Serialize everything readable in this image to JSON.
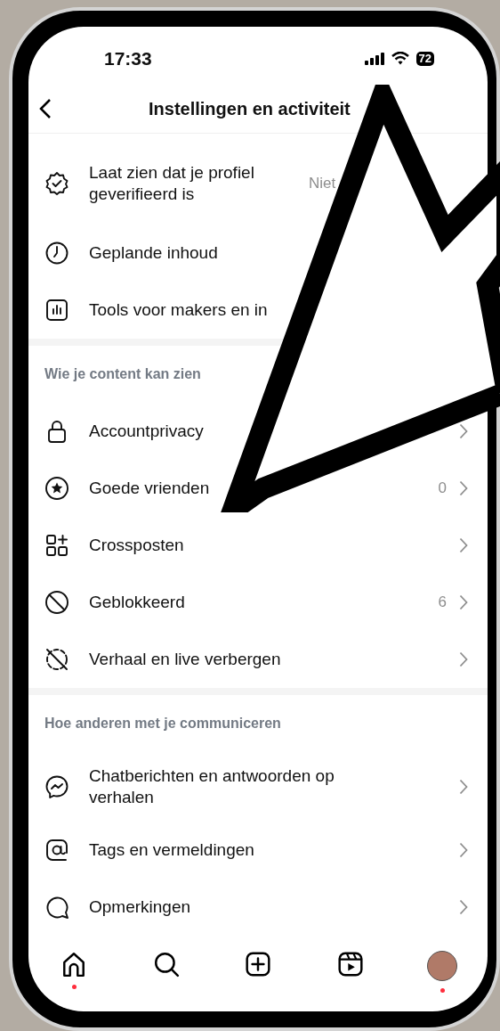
{
  "status_bar": {
    "time": "17:33",
    "battery": "72"
  },
  "header": {
    "title": "Instellingen en activiteit"
  },
  "sections": [
    {
      "items": [
        {
          "kind": "verified",
          "label": "Laat zien dat je profiel geverifieerd is",
          "value": "Niet",
          "chevron": false
        },
        {
          "kind": "clock",
          "label": "Geplande inhoud",
          "chevron": false
        },
        {
          "kind": "chart",
          "label": "Tools voor makers en in",
          "chevron": false
        }
      ]
    },
    {
      "header": "Wie je content kan zien",
      "items": [
        {
          "kind": "lock",
          "label": "Accountprivacy",
          "chevron": true
        },
        {
          "kind": "star",
          "label": "Goede vrienden",
          "value": "0",
          "chevron": true
        },
        {
          "kind": "crosspost",
          "label": "Crossposten",
          "chevron": true
        },
        {
          "kind": "blocked",
          "label": "Geblokkeerd",
          "value": "6",
          "chevron": true
        },
        {
          "kind": "hide",
          "label": "Verhaal en live verbergen",
          "chevron": true
        }
      ]
    },
    {
      "header": "Hoe anderen met je communiceren",
      "items": [
        {
          "kind": "messenger",
          "label": "Chatberichten en antwoorden op verhalen",
          "chevron": true
        },
        {
          "kind": "at",
          "label": "Tags en vermeldingen",
          "chevron": true
        },
        {
          "kind": "comment",
          "label": "Opmerkingen",
          "chevron": true
        }
      ]
    }
  ],
  "nav": [
    {
      "kind": "home",
      "dot": true
    },
    {
      "kind": "search",
      "dot": false
    },
    {
      "kind": "create",
      "dot": false
    },
    {
      "kind": "reels",
      "dot": false
    },
    {
      "kind": "profile",
      "dot": true
    }
  ]
}
